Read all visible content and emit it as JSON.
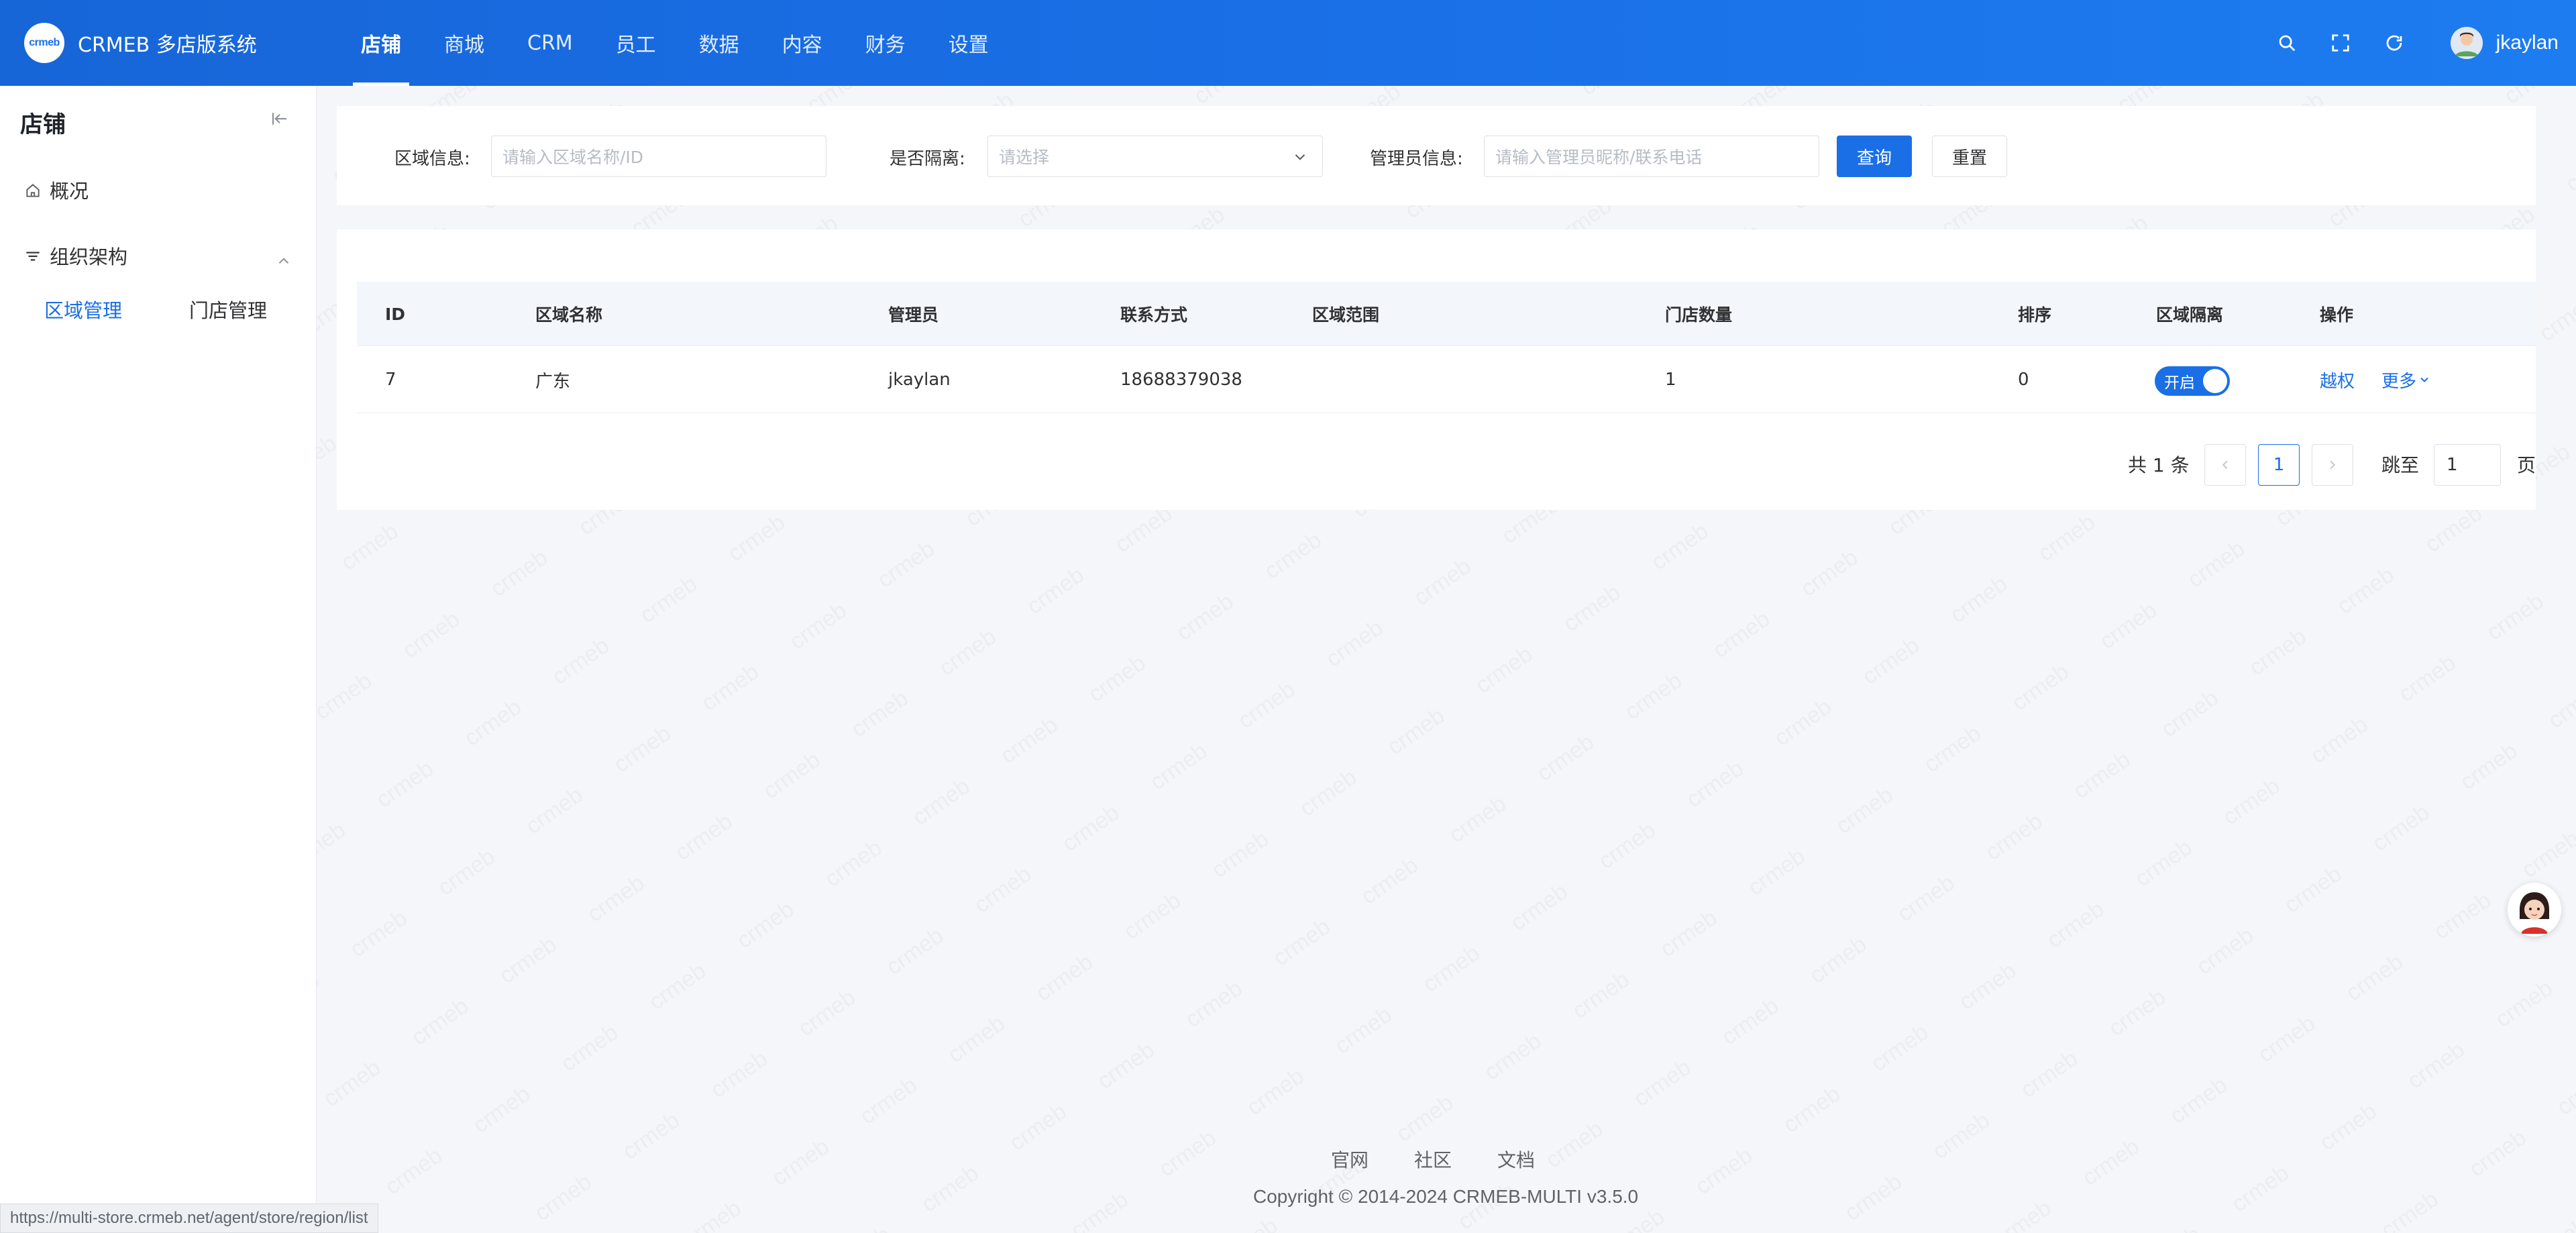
{
  "header": {
    "logo_text": "crmeb",
    "brand_name": "CRMEB 多店版系统",
    "nav": [
      {
        "label": "店铺",
        "active": true
      },
      {
        "label": "商城"
      },
      {
        "label": "CRM"
      },
      {
        "label": "员工"
      },
      {
        "label": "数据"
      },
      {
        "label": "内容"
      },
      {
        "label": "财务"
      },
      {
        "label": "设置"
      }
    ],
    "icons": [
      "search-icon",
      "fullscreen-icon",
      "refresh-icon"
    ],
    "username": "jkaylan"
  },
  "sidebar": {
    "title": "店铺",
    "items": [
      {
        "label": "概况",
        "icon": "home-icon"
      },
      {
        "label": "组织架构",
        "icon": "filter-icon",
        "expanded": true
      }
    ],
    "sub_items": [
      {
        "label": "区域管理",
        "active": true
      },
      {
        "label": "门店管理"
      }
    ]
  },
  "filters": {
    "region_label": "区域信息:",
    "region_placeholder": "请输入区域名称/ID",
    "isolation_label": "是否隔离:",
    "isolation_placeholder": "请选择",
    "admin_label": "管理员信息:",
    "admin_placeholder": "请输入管理员昵称/联系电话",
    "query_label": "查询",
    "reset_label": "重置"
  },
  "table": {
    "columns": [
      "ID",
      "区域名称",
      "管理员",
      "联系方式",
      "区域范围",
      "门店数量",
      "排序",
      "区域隔离",
      "操作"
    ],
    "rows": [
      {
        "id": "7",
        "name": "广东",
        "admin": "jkaylan",
        "phone": "18688379038",
        "range": "",
        "store_count": "1",
        "sort": "0",
        "isolation_label": "开启",
        "isolation_on": true,
        "action_1": "越权",
        "action_more": "更多"
      }
    ]
  },
  "pagination": {
    "total_text": "共 1 条",
    "current_page": "1",
    "jump_label": "跳至",
    "jump_value": "1",
    "page_suffix": "页"
  },
  "footer": {
    "links": [
      "官网",
      "社区",
      "文档"
    ],
    "copyright": "Copyright © 2014-2024 CRMEB-MULTI v3.5.0"
  },
  "status_bar_url": "https://multi-store.crmeb.net/agent/store/region/list",
  "watermark_text": "crmeb",
  "colors": {
    "primary": "#1a6fe6",
    "header_gradient_start": "#1766d8",
    "header_gradient_end": "#1d7cf0",
    "page_bg": "#f4f6f9"
  }
}
